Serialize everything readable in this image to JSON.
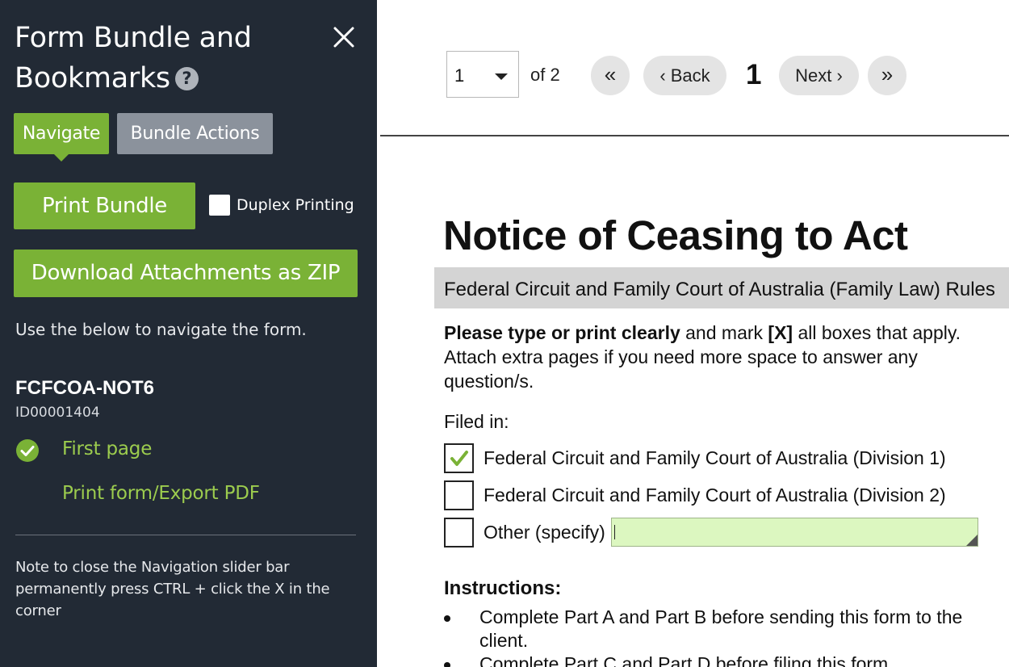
{
  "sidebar": {
    "title": "Form Bundle and Bookmarks",
    "help_symbol": "?",
    "tabs": {
      "navigate": "Navigate",
      "bundle_actions": "Bundle Actions"
    },
    "print_bundle_label": "Print Bundle",
    "duplex_label": "Duplex Printing",
    "download_zip_label": "Download Attachments as ZIP",
    "info_text": "Use the below to navigate the form.",
    "form_code": "FCFCOA-NOT6",
    "form_id": "ID00001404",
    "nav_items": [
      {
        "label": "First page",
        "completed": true
      },
      {
        "label": "Print form/Export PDF",
        "completed": false
      }
    ],
    "note_line1": "Note to close the Navigation slider bar",
    "note_line2": "permanently press CTRL + click the X in the corner",
    "colors": {
      "background": "#222a35",
      "accent": "#7ab236",
      "link": "#9ccc4e"
    }
  },
  "pager": {
    "selected_page": "1",
    "of_total": "of 2",
    "first_symbol": "«",
    "back_label": "‹  Back",
    "current_page": "1",
    "next_label": "Next  ›",
    "last_symbol": "»"
  },
  "document": {
    "title": "Notice of Ceasing to Act",
    "rules_line": "Federal Circuit and Family Court of Australia (Family Law) Rules",
    "intro_bold": "Please type or print clearly",
    "intro_mid": " and mark ",
    "intro_x": "[X]",
    "intro_rest": " all boxes that apply. Attach extra pages if you need more space to answer any question/s.",
    "filed_in_label": "Filed in:",
    "options": [
      {
        "label": "Federal Circuit and Family Court of Australia (Division 1)",
        "checked": true
      },
      {
        "label": "Federal Circuit and Family Court of Australia (Division 2)",
        "checked": false
      },
      {
        "label": "Other (specify)",
        "checked": false
      }
    ],
    "other_value": "",
    "instructions_heading": "Instructions:",
    "instructions": [
      "Complete Part A and Part B before sending this form to the client.",
      "Complete Part C and Part D before filing this form."
    ],
    "colors": {
      "input_fill": "#dcf7c0",
      "checkmark": "#7ab236"
    }
  }
}
